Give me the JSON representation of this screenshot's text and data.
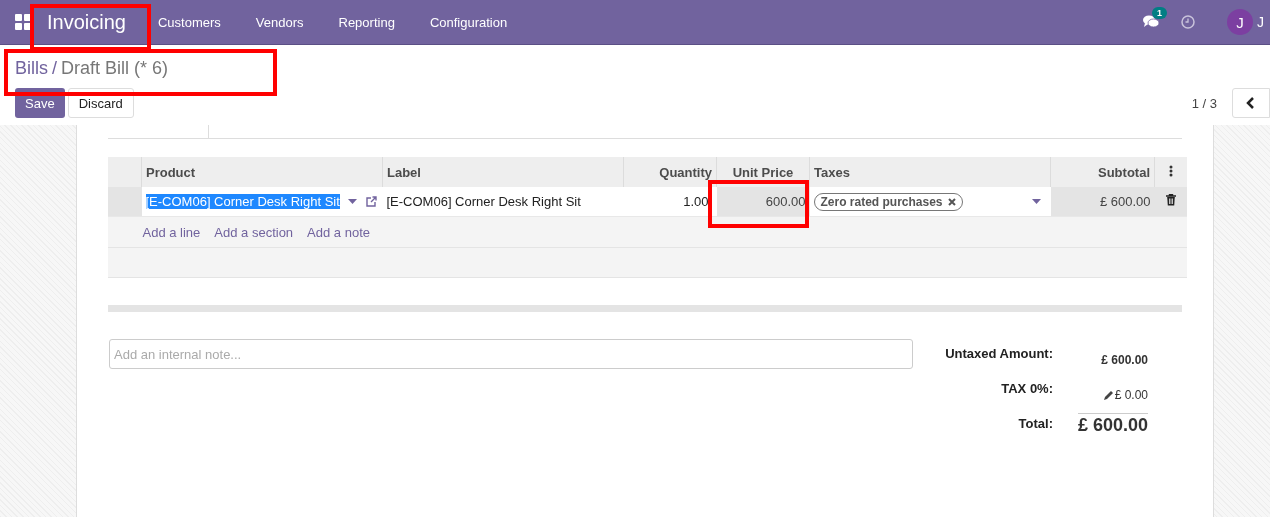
{
  "navbar": {
    "app_name": "Invoicing",
    "menu": [
      "Customers",
      "Vendors",
      "Reporting",
      "Configuration"
    ],
    "messages_badge": "1",
    "avatar_letter": "J",
    "user_name": "J"
  },
  "breadcrumb": {
    "parent": "Bills",
    "separator": "/",
    "current": "Draft Bill (* 6)"
  },
  "actions": {
    "save": "Save",
    "discard": "Discard",
    "pager": "1 / 3"
  },
  "table": {
    "columns": [
      "Product",
      "Label",
      "Quantity",
      "Unit Price",
      "Taxes",
      "Subtotal"
    ],
    "rows": [
      {
        "product": "[E-COM06] Corner Desk Right Sit",
        "label": "[E-COM06] Corner Desk Right Sit",
        "quantity": "1.00",
        "unit_price": "600.00",
        "taxes": [
          "Zero rated purchases"
        ],
        "subtotal": "£ 600.00"
      }
    ],
    "add_links": [
      "Add a line",
      "Add a section",
      "Add a note"
    ]
  },
  "note_field": {
    "placeholder": "Add an internal note..."
  },
  "totals": [
    {
      "label": "Untaxed Amount:",
      "value": "£ 600.00",
      "kind": "plain"
    },
    {
      "label": "TAX 0%:",
      "value": "£ 0.00",
      "kind": "editable"
    },
    {
      "label": "Total:",
      "value": "£ 600.00",
      "kind": "grand"
    }
  ]
}
